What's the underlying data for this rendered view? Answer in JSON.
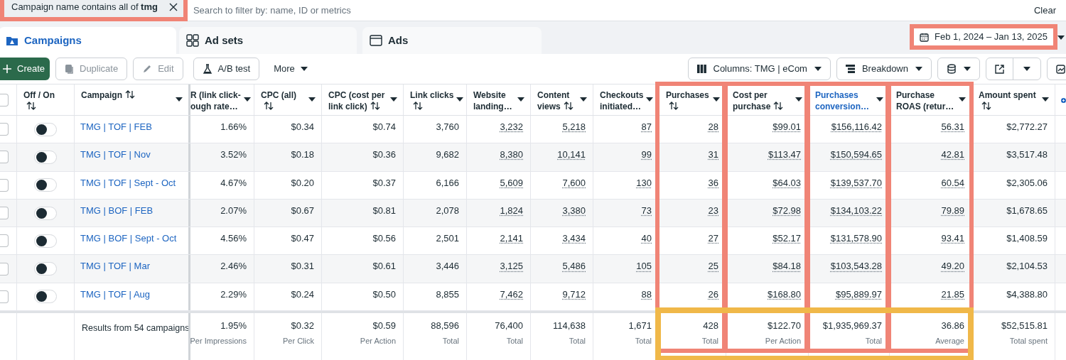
{
  "filter": {
    "chip": "Campaign name contains all of **tmg**",
    "highlighted": true,
    "placeholder": "Search to filter by: name, ID or metrics",
    "clear": "Clear"
  },
  "tabs": [
    {
      "label": "Campaigns",
      "selected": true
    },
    {
      "label": "Ad sets",
      "selected": false
    },
    {
      "label": "Ads",
      "selected": false
    }
  ],
  "date_range": {
    "label": "Feb 1, 2024 – Jan 13, 2025",
    "highlighted": true
  },
  "toolbar": {
    "left": [
      {
        "kind": "create",
        "label": "Create",
        "disabled": false
      },
      {
        "kind": "duplicate",
        "label": "Duplicate",
        "disabled": true
      },
      {
        "kind": "edit",
        "label": "Edit",
        "disabled": true
      },
      {
        "kind": "abtest",
        "label": "A/B test",
        "disabled": false
      },
      {
        "kind": "more",
        "label": "More",
        "disabled": false
      }
    ],
    "columns_button": "Columns: TMG | eCom",
    "breakdown_button": "Breakdown"
  },
  "table": {
    "select_all": {
      "checked": false
    },
    "columns": [
      {
        "kind": "toggle",
        "label": "Off / On",
        "sortable": true,
        "highlighted": false,
        "active": false
      },
      {
        "kind": "name",
        "label": "Campaign",
        "sortable": true,
        "highlighted": false,
        "active": false
      },
      {
        "kind": "metric",
        "label": "R (link click-\nough rate…",
        "sortable": false,
        "highlighted": false,
        "active": false,
        "dotted": false
      },
      {
        "kind": "metric",
        "label": "CPC (all)",
        "sortable": true,
        "highlighted": false,
        "active": false,
        "dotted": false
      },
      {
        "kind": "metric",
        "label": "CPC (cost per\nlink click)",
        "sortable": true,
        "highlighted": false,
        "active": false,
        "dotted": false
      },
      {
        "kind": "metric",
        "label": "Link clicks",
        "sortable": true,
        "highlighted": false,
        "active": false,
        "dotted": false
      },
      {
        "kind": "metric",
        "label": "Website\nlanding…",
        "sortable": false,
        "highlighted": false,
        "active": false,
        "dotted": true
      },
      {
        "kind": "metric",
        "label": "Content\nviews",
        "sortable": true,
        "highlighted": false,
        "active": false,
        "dotted": true
      },
      {
        "kind": "metric",
        "label": "Checkouts\ninitiated…",
        "sortable": false,
        "highlighted": false,
        "active": false,
        "dotted": true
      },
      {
        "kind": "metric",
        "label": "Purchases",
        "sortable": true,
        "highlighted": true,
        "active": false,
        "dotted": true
      },
      {
        "kind": "metric",
        "label": "Cost per\npurchase",
        "sortable": true,
        "highlighted": true,
        "active": false,
        "dotted": true
      },
      {
        "kind": "metric",
        "label": "Purchases\nconversion…",
        "sortable": false,
        "highlighted": true,
        "active": true,
        "dotted": true
      },
      {
        "kind": "metric",
        "label": "Purchase\nROAS (retur…",
        "sortable": false,
        "highlighted": true,
        "active": false,
        "dotted": true
      },
      {
        "kind": "metric",
        "label": "Amount spent",
        "sortable": true,
        "highlighted": false,
        "active": false,
        "dotted": false
      }
    ],
    "rows": [
      {
        "checked": false,
        "on": false,
        "name": "TMG | TOF | FEB",
        "values": [
          "1.66%",
          "$0.34",
          "$0.74",
          "3,760",
          "3,232",
          "5,218",
          "87",
          "28",
          "$99.01",
          "$156,116.42",
          "56.31",
          "$2,772.27"
        ]
      },
      {
        "checked": false,
        "on": false,
        "name": "TMG | TOF | Nov",
        "values": [
          "3.52%",
          "$0.18",
          "$0.36",
          "9,682",
          "8,380",
          "10,141",
          "99",
          "31",
          "$113.47",
          "$150,594.65",
          "42.81",
          "$3,517.48"
        ]
      },
      {
        "checked": false,
        "on": false,
        "name": "TMG | TOF | Sept - Oct",
        "values": [
          "4.67%",
          "$0.20",
          "$0.37",
          "6,166",
          "5,609",
          "7,600",
          "130",
          "36",
          "$64.03",
          "$139,537.70",
          "60.54",
          "$2,305.06"
        ]
      },
      {
        "checked": false,
        "on": false,
        "name": "TMG | BOF | FEB",
        "values": [
          "2.07%",
          "$0.67",
          "$0.81",
          "2,078",
          "1,824",
          "3,380",
          "73",
          "23",
          "$72.98",
          "$134,103.22",
          "79.89",
          "$1,678.65"
        ]
      },
      {
        "checked": false,
        "on": false,
        "name": "TMG | BOF | Sept - Oct",
        "values": [
          "4.56%",
          "$0.47",
          "$0.56",
          "2,501",
          "2,141",
          "3,434",
          "40",
          "27",
          "$52.17",
          "$131,578.90",
          "93.41",
          "$1,408.59"
        ]
      },
      {
        "checked": false,
        "on": false,
        "name": "TMG | TOF | Mar",
        "values": [
          "2.46%",
          "$0.31",
          "$0.61",
          "3,446",
          "3,125",
          "5,486",
          "105",
          "25",
          "$84.18",
          "$103,543.28",
          "49.20",
          "$2,104.53"
        ]
      },
      {
        "checked": false,
        "on": false,
        "name": "TMG | TOF | Aug",
        "values": [
          "2.29%",
          "$0.24",
          "$0.50",
          "8,855",
          "7,462",
          "9,712",
          "88",
          "26",
          "$168.80",
          "$95,889.97",
          "21.85",
          "$4,388.80"
        ]
      }
    ],
    "summary": {
      "label": "Results from 54 campaigns",
      "highlighted": true,
      "totals": [
        {
          "value": "1.95%",
          "label": "Per Impressions"
        },
        {
          "value": "$0.32",
          "label": "Per Click"
        },
        {
          "value": "$0.59",
          "label": "Per Action"
        },
        {
          "value": "88,596",
          "label": "Total"
        },
        {
          "value": "76,400",
          "label": "Total"
        },
        {
          "value": "114,638",
          "label": "Total"
        },
        {
          "value": "1,671",
          "label": "Total"
        },
        {
          "value": "428",
          "label": "Total"
        },
        {
          "value": "$122.70",
          "label": "Per Action"
        },
        {
          "value": "$1,935,969.37",
          "label": "Total"
        },
        {
          "value": "36.86",
          "label": "Average"
        },
        {
          "value": "$52,515.81",
          "label": "Total spent"
        }
      ]
    }
  }
}
